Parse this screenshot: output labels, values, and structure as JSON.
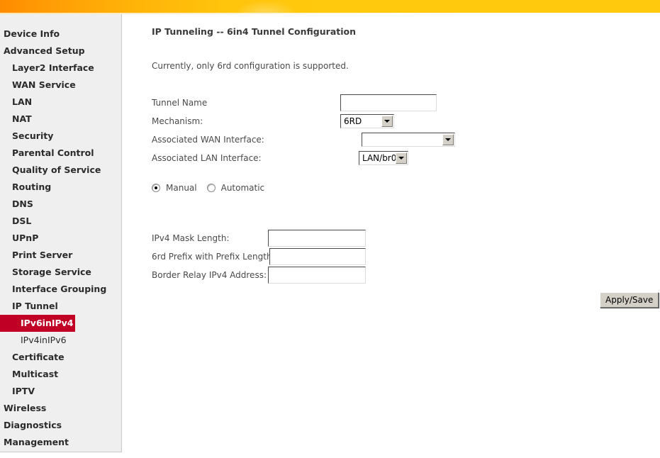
{
  "banner": {
    "accent_left": "#ff8c00",
    "accent_right": "#ffc90d"
  },
  "sidebar": {
    "active_color": "#c00024",
    "items": [
      {
        "label": "Device Info",
        "level": "top"
      },
      {
        "label": "Advanced Setup",
        "level": "top"
      },
      {
        "label": "Layer2 Interface",
        "level": "sub"
      },
      {
        "label": "WAN Service",
        "level": "sub"
      },
      {
        "label": "LAN",
        "level": "sub"
      },
      {
        "label": "NAT",
        "level": "sub"
      },
      {
        "label": "Security",
        "level": "sub"
      },
      {
        "label": "Parental Control",
        "level": "sub"
      },
      {
        "label": "Quality of Service",
        "level": "sub"
      },
      {
        "label": "Routing",
        "level": "sub"
      },
      {
        "label": "DNS",
        "level": "sub"
      },
      {
        "label": "DSL",
        "level": "sub"
      },
      {
        "label": "UPnP",
        "level": "sub"
      },
      {
        "label": "Print Server",
        "level": "sub"
      },
      {
        "label": "Storage Service",
        "level": "sub"
      },
      {
        "label": "Interface Grouping",
        "level": "sub"
      },
      {
        "label": "IP Tunnel",
        "level": "sub"
      },
      {
        "label": "IPv6inIPv4",
        "level": "active"
      },
      {
        "label": "IPv4inIPv6",
        "level": "sub2"
      },
      {
        "label": "Certificate",
        "level": "sub"
      },
      {
        "label": "Multicast",
        "level": "sub"
      },
      {
        "label": "IPTV",
        "level": "sub"
      },
      {
        "label": "Wireless",
        "level": "top"
      },
      {
        "label": "Diagnostics",
        "level": "top"
      },
      {
        "label": "Management",
        "level": "top"
      }
    ]
  },
  "main": {
    "title": "IP Tunneling -- 6in4 Tunnel Configuration",
    "note": "Currently, only 6rd configuration is supported.",
    "fields": {
      "tunnel_name": {
        "label": "Tunnel Name",
        "value": "",
        "placeholder": ""
      },
      "mechanism": {
        "label": "Mechanism:",
        "value": "6RD"
      },
      "wan_interface": {
        "label": "Associated WAN Interface:",
        "value": ""
      },
      "lan_interface": {
        "label": "Associated LAN Interface:",
        "value": "LAN/br0"
      },
      "ipv4_mask_length": {
        "label": "IPv4 Mask Length:",
        "value": "",
        "placeholder": ""
      },
      "prefix_with_length": {
        "label": "6rd Prefix with Prefix Length:",
        "value": "",
        "placeholder": ""
      },
      "border_relay": {
        "label": "Border Relay IPv4 Address:",
        "value": "",
        "placeholder": ""
      }
    },
    "mode_radio": {
      "manual": {
        "label": "Manual",
        "selected": true
      },
      "automatic": {
        "label": "Automatic",
        "selected": false
      }
    },
    "apply_label": "Apply/Save"
  }
}
